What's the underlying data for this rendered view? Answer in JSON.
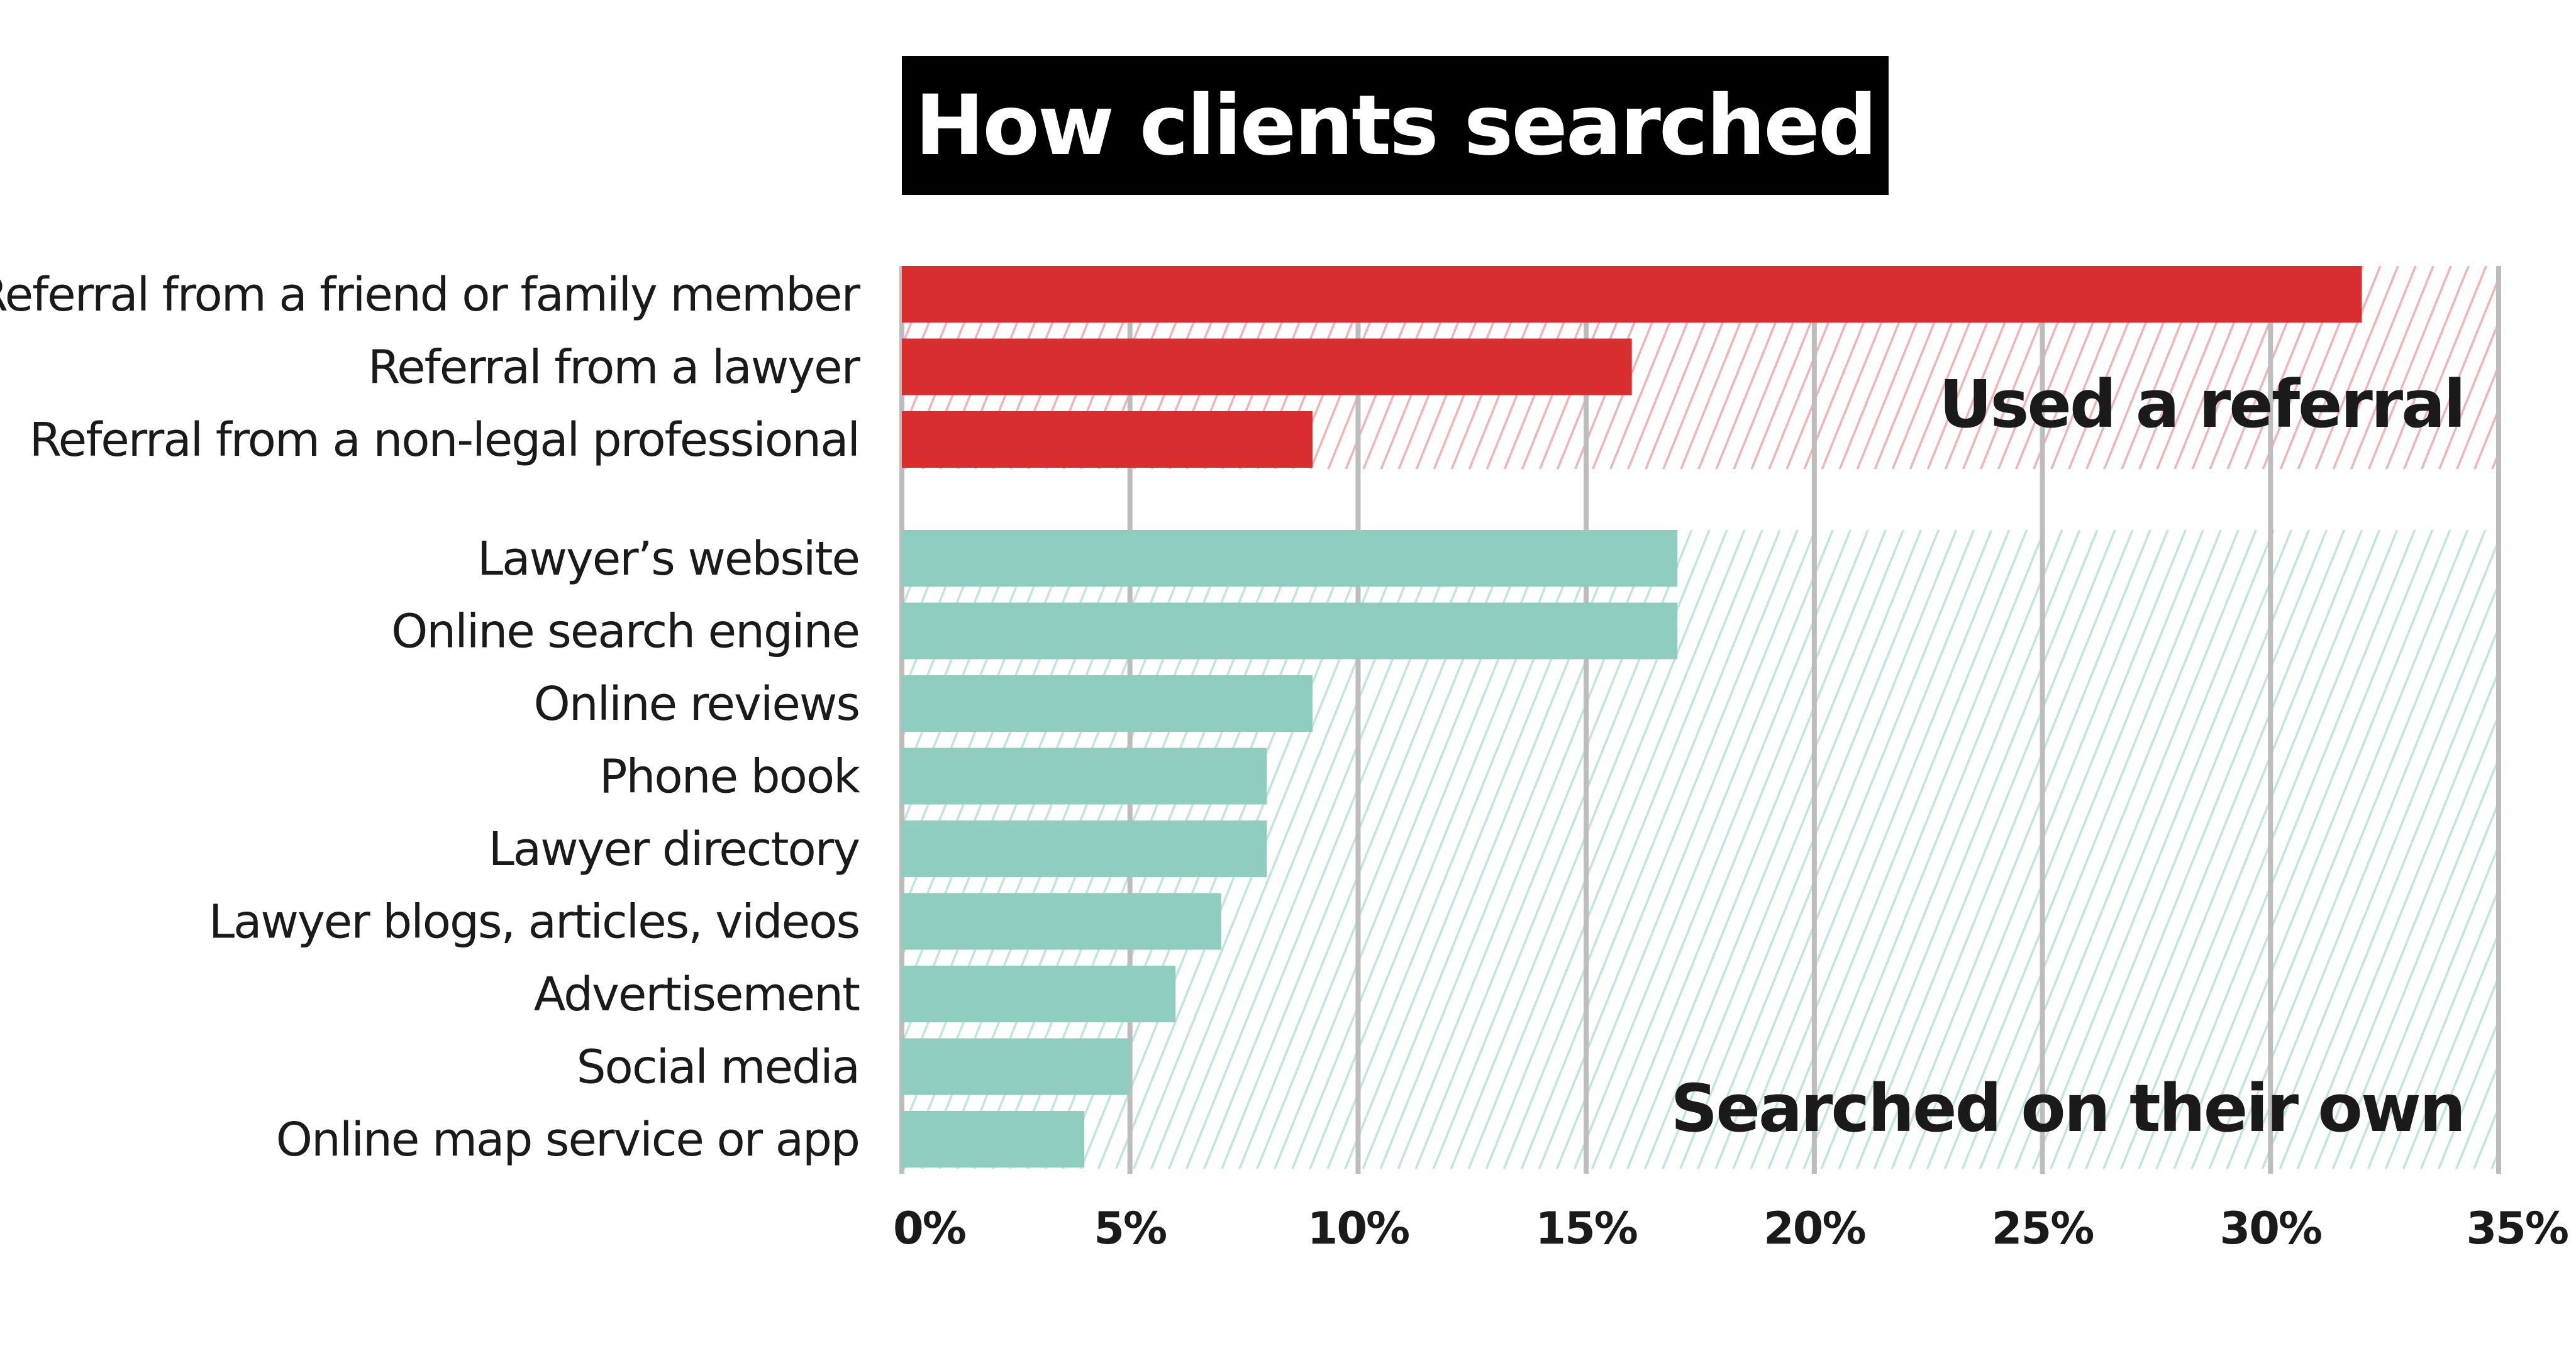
{
  "chart_data": {
    "type": "bar",
    "orientation": "horizontal",
    "title": "How clients searched",
    "xlabel": "",
    "ylabel": "",
    "xlim": [
      0,
      35
    ],
    "x_ticks": [
      0,
      5,
      10,
      15,
      20,
      25,
      30,
      35
    ],
    "x_tick_labels": [
      "0%",
      "5%",
      "10%",
      "15%",
      "20%",
      "25%",
      "30%",
      "35%"
    ],
    "grid": "vertical",
    "unit": "%",
    "groups": [
      {
        "name": "Used a referral",
        "label_position": "top-right",
        "color": "#d92d2f",
        "hatch_color": "#f2b3b4",
        "categories": [
          "Referral from a friend or family member",
          "Referral from a lawyer",
          "Referral from a non-legal professional"
        ],
        "values": [
          32,
          16,
          9
        ]
      },
      {
        "name": "Searched on their own",
        "label_position": "bottom-right",
        "color": "#8ecdc0",
        "hatch_color": "#bfe6de",
        "categories": [
          "Lawyer’s website",
          "Online search engine",
          "Online reviews",
          "Phone book",
          "Lawyer directory",
          "Lawyer blogs, articles, videos",
          "Advertisement",
          "Social media",
          "Online map service or app"
        ],
        "values": [
          17,
          17,
          9,
          8,
          8,
          7,
          6,
          5,
          4
        ]
      }
    ]
  },
  "colors": {
    "gridline": "#bdbdbd",
    "text": "#1a1a1a",
    "title_bg": "#000000",
    "title_fg": "#ffffff"
  }
}
